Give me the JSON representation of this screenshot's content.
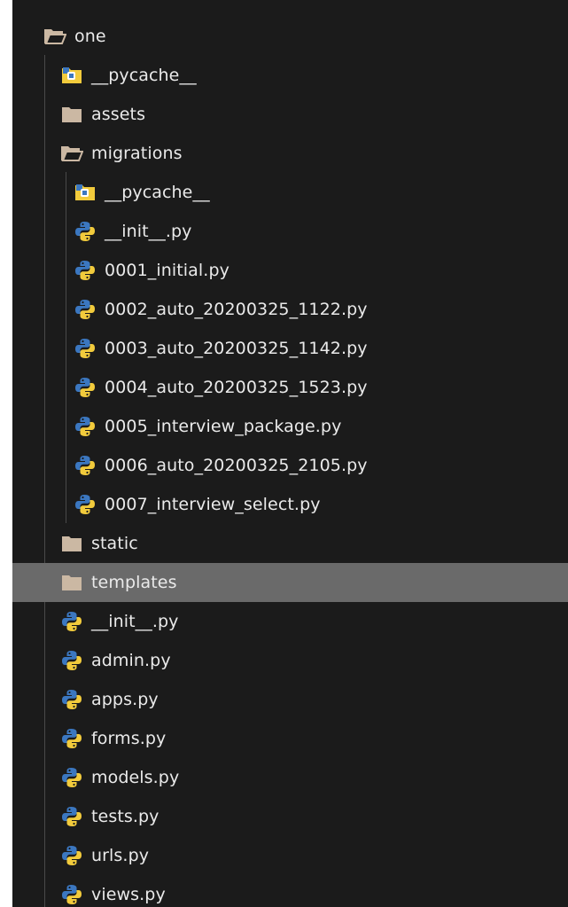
{
  "tree": {
    "root": {
      "label": "one",
      "icon": "folder-open-icon"
    },
    "items": [
      {
        "label": "__pycache__",
        "icon": "pycache-folder-icon",
        "depth": 1
      },
      {
        "label": "assets",
        "icon": "folder-icon",
        "depth": 1
      },
      {
        "label": "migrations",
        "icon": "folder-open-icon",
        "depth": 1
      },
      {
        "label": "__pycache__",
        "icon": "pycache-folder-icon",
        "depth": 2
      },
      {
        "label": "__init__.py",
        "icon": "python-icon",
        "depth": 2
      },
      {
        "label": "0001_initial.py",
        "icon": "python-icon",
        "depth": 2
      },
      {
        "label": "0002_auto_20200325_1122.py",
        "icon": "python-icon",
        "depth": 2
      },
      {
        "label": "0003_auto_20200325_1142.py",
        "icon": "python-icon",
        "depth": 2
      },
      {
        "label": "0004_auto_20200325_1523.py",
        "icon": "python-icon",
        "depth": 2
      },
      {
        "label": "0005_interview_package.py",
        "icon": "python-icon",
        "depth": 2
      },
      {
        "label": "0006_auto_20200325_2105.py",
        "icon": "python-icon",
        "depth": 2
      },
      {
        "label": "0007_interview_select.py",
        "icon": "python-icon",
        "depth": 2
      },
      {
        "label": "static",
        "icon": "folder-icon",
        "depth": 1
      },
      {
        "label": "templates",
        "icon": "folder-icon",
        "depth": 1,
        "selected": true
      },
      {
        "label": "__init__.py",
        "icon": "python-icon",
        "depth": 1
      },
      {
        "label": "admin.py",
        "icon": "python-icon",
        "depth": 1
      },
      {
        "label": "apps.py",
        "icon": "python-icon",
        "depth": 1
      },
      {
        "label": "forms.py",
        "icon": "python-icon",
        "depth": 1
      },
      {
        "label": "models.py",
        "icon": "python-icon",
        "depth": 1
      },
      {
        "label": "tests.py",
        "icon": "python-icon",
        "depth": 1
      },
      {
        "label": "urls.py",
        "icon": "python-icon",
        "depth": 1
      },
      {
        "label": "views.py",
        "icon": "python-icon",
        "depth": 1
      }
    ]
  },
  "colors": {
    "background": "#1b1b1b",
    "selected_row": "#6a6a6a",
    "text": "#eaeaea",
    "folder": "#cbb8a3",
    "python_blue": "#3b77c0",
    "python_yellow": "#f2cb3c"
  }
}
